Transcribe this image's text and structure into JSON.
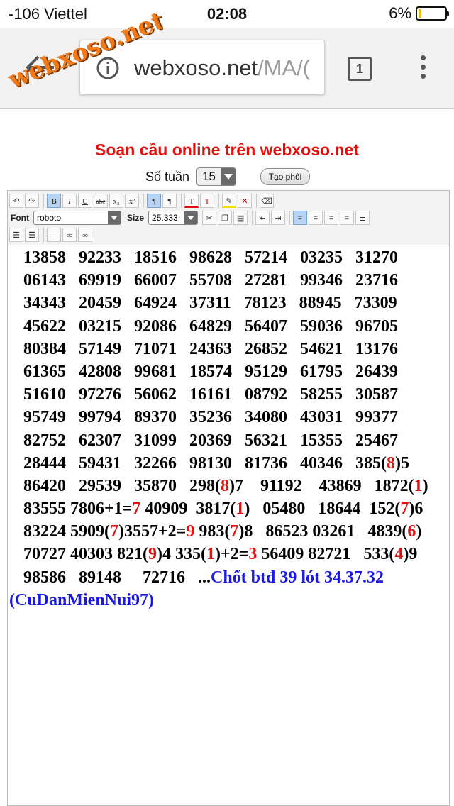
{
  "status_bar": {
    "carrier": "-106 Viettel",
    "time": "02:08",
    "battery": "6%"
  },
  "browser": {
    "url_host": "webxoso.net",
    "url_path": "/MA/(",
    "tab_count": "1"
  },
  "watermark": "webxoso.net",
  "page": {
    "title": "Soạn cầu online trên webxoso.net",
    "week_label": "Số tuần",
    "week_value": "15",
    "create_button": "Tạo phôi"
  },
  "toolbar": {
    "font_label": "Font",
    "font_value": "roboto",
    "size_label": "Size",
    "size_value": "25.333",
    "buttons": {
      "bold": "B",
      "italic": "I",
      "underline": "U",
      "strike": "abc",
      "sub": "x₂",
      "sup": "x²"
    }
  },
  "content": {
    "rows": [
      "13858   92233   18516   98628   57214   03235   31270",
      "06143   69919   66007   55708   27281   99346   23716",
      "34343   20459   64924   37311   78123   88945   73309",
      "45622   03215   92086   64829   56407   59036   96705",
      "80384   57149   71071   24363   26852   54621   13176",
      "61365   42808   99681   18574   95129   61795   26439",
      "51610   97276   56062   16161   08792   58255   30587",
      "95749   99794   89370   35236   34080   43031   99377",
      "82752   62307   31099   20369   56321   15355   25467"
    ],
    "row10": {
      "a": "28444   59431   32266   98130   81736   40346   385(",
      "r": "8",
      "b": ")5"
    },
    "row11": {
      "a": "86420   29539   35870   298(",
      "r1": "8",
      "b": ")7    91192    43869   1872(",
      "r2": "1",
      "c": ")"
    },
    "row12": {
      "a": "83555 7806+1=",
      "r1": "7",
      "b": " 40909  3817(",
      "r2": "1",
      "c": ")   05480   18644  152(",
      "r3": "7",
      "d": ")6"
    },
    "row13": {
      "a": "83224 5909(",
      "r1": "7",
      "b": ")3557+2=",
      "r2": "9",
      "c": " 983(",
      "r3": "7",
      "d": ")8   86523 03261   4839(",
      "r4": "6",
      "e": ")"
    },
    "row14": {
      "a": "70727 40303 821(",
      "r1": "9",
      "b": ")4 335(",
      "r2": "1",
      "c": ")+2=",
      "r3": "3",
      "d": " 56409 82721   533(",
      "r4": "4",
      "e": ")9"
    },
    "row15": {
      "a": "98586   89148     72716   ...",
      "blue": "Chốt btđ 39 lót 34.37.32"
    },
    "signature": "(CuDanMienNui97)"
  }
}
